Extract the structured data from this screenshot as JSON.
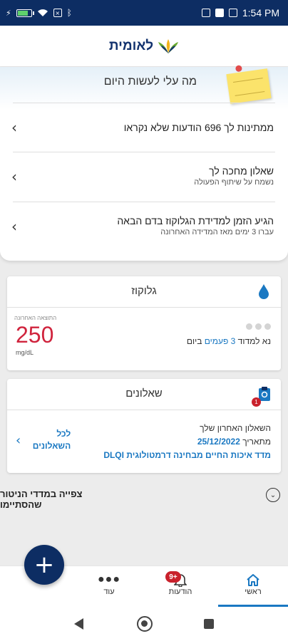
{
  "status_bar": {
    "time": "1:54 PM"
  },
  "header": {
    "logo_text": "לאומית"
  },
  "todo": {
    "title": "מה עלי לעשות היום",
    "rows": [
      {
        "main": "ממתינות לך 696 הודעות שלא נקראו"
      },
      {
        "main": "שאלון מחכה לך",
        "sub": "נשמח על שיתוף הפעולה"
      },
      {
        "main": "הגיע הזמן למדידת הגלוקוז בדם הבאה",
        "sub": "עברו 3 ימים מאז המדידה האחרונה"
      }
    ]
  },
  "glucose": {
    "title": "גלוקוז",
    "last_label": "התוצאה האחרונה",
    "value": "250",
    "unit": "mg/dL",
    "measure_prefix": "נא למדוד ",
    "measure_highlight": "3 פעמים",
    "measure_suffix": " ביום"
  },
  "questionnaires": {
    "title": "שאלונים",
    "badge": "1",
    "last_label": "השאלון האחרון שלך",
    "date_prefix": "מתאריך ",
    "date": "25/12/2022",
    "name": "מדד איכות החיים מבחינה דרמטולוגית DLQI",
    "all_link": "לכל השאלונים"
  },
  "monitor": {
    "label": "צפייה במדדי הניטור שהסתיימו"
  },
  "bottom_nav": {
    "items": [
      {
        "label": "ראשי"
      },
      {
        "label": "הודעות"
      },
      {
        "label": "עוד"
      }
    ],
    "messages_badge": "9+"
  },
  "fab": {
    "symbol": "+"
  },
  "colors": {
    "brand": "#0d2d63",
    "accent": "#1a78c2",
    "alert": "#d0243d"
  }
}
